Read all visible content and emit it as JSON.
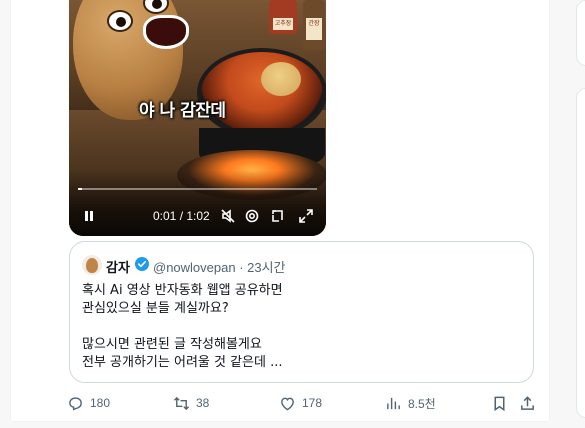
{
  "video": {
    "subtitle": "야 나 감잔데",
    "jar1_label": "고추장",
    "jar2_label": "간장",
    "time": "0:01 / 1:02",
    "progress_fraction": 0.016
  },
  "quote": {
    "author_name": "감자",
    "handle_time": "@nowlovepan · 23시간",
    "body": "혹시 Ai 영상 반자동화 웹앱 공유하면\n관심있으실 분들 계실까요?\n\n많으시면 관련된 글 작성해볼게요\n전부 공개하기는 어려울 것 같은데 ..."
  },
  "actions": {
    "replies": "180",
    "retweets": "38",
    "likes": "178",
    "views": "8.5천"
  },
  "colors": {
    "verified": "#1d9bf0",
    "muted_text": "#536471",
    "border": "#cfd9de"
  },
  "icons": [
    "pause-icon",
    "mute-icon",
    "settings-icon",
    "pip-icon",
    "fullscreen-icon",
    "verified-icon",
    "reply-icon",
    "retweet-icon",
    "like-icon",
    "views-icon",
    "bookmark-icon",
    "share-icon"
  ]
}
